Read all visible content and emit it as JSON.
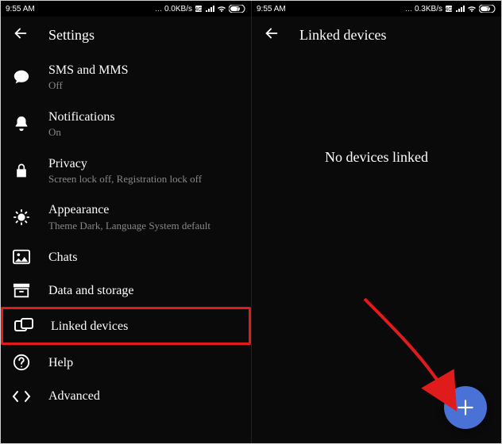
{
  "left": {
    "status": {
      "time": "9:55 AM",
      "net_speed": "0.0KB/s",
      "battery": "73"
    },
    "header": {
      "title": "Settings"
    },
    "items": [
      {
        "icon": "chat-bubble-icon",
        "label": "SMS and MMS",
        "sub": "Off"
      },
      {
        "icon": "bell-icon",
        "label": "Notifications",
        "sub": "On"
      },
      {
        "icon": "lock-icon",
        "label": "Privacy",
        "sub": "Screen lock off, Registration lock off"
      },
      {
        "icon": "sun-icon",
        "label": "Appearance",
        "sub": "Theme Dark, Language System default"
      },
      {
        "icon": "image-icon",
        "label": "Chats",
        "sub": ""
      },
      {
        "icon": "archive-icon",
        "label": "Data and storage",
        "sub": ""
      },
      {
        "icon": "devices-icon",
        "label": "Linked devices",
        "sub": "",
        "highlight": true
      },
      {
        "icon": "help-circle-icon",
        "label": "Help",
        "sub": ""
      },
      {
        "icon": "code-icon",
        "label": "Advanced",
        "sub": ""
      }
    ]
  },
  "right": {
    "status": {
      "time": "9:55 AM",
      "net_speed": "0.3KB/s",
      "battery": "73"
    },
    "header": {
      "title": "Linked devices"
    },
    "empty_text": "No devices linked",
    "fab_label": "+"
  }
}
